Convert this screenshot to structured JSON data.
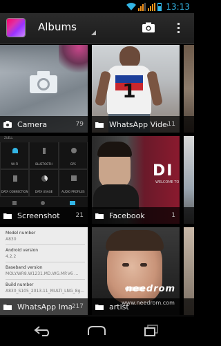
{
  "status_bar": {
    "time": "13:13",
    "accent": "#33b5e5"
  },
  "action_bar": {
    "title": "Albums"
  },
  "albums": [
    {
      "name": "Camera",
      "count": "79",
      "icon": "camera-icon"
    },
    {
      "name": "WhatsApp Video",
      "count": "11",
      "icon": "folder-icon"
    },
    {
      "name": "Screenshot",
      "count": "21",
      "icon": "folder-icon"
    },
    {
      "name": "Facebook",
      "count": "1",
      "icon": "folder-icon"
    },
    {
      "name": "WhatsApp Images",
      "count": "217",
      "icon": "folder-icon"
    },
    {
      "name": "artist",
      "count": "",
      "icon": "folder-icon"
    }
  ],
  "thumbnails": {
    "screenshot": {
      "header": "ZUELL",
      "tiles": [
        "WI-FI",
        "BLUETOOTH",
        "GPS",
        "DATA CONNECTION",
        "DATA USAGE",
        "AUDIO PROFILES"
      ]
    },
    "facebook": {
      "logo": "DI M",
      "sub": "WELCOME TO"
    },
    "whatsapp_images": {
      "lines": [
        "Model number",
        "A830",
        "Android version",
        "4.2.2",
        "Baseband version",
        "MOLY.WR8.W1231.MD.WG.MP.V6 ...",
        "Build number",
        "A830_S105_2013.11_MULTI_LNG_8g..."
      ]
    }
  },
  "watermark": {
    "logo": "needrom",
    "url": "www.needrom.com"
  }
}
